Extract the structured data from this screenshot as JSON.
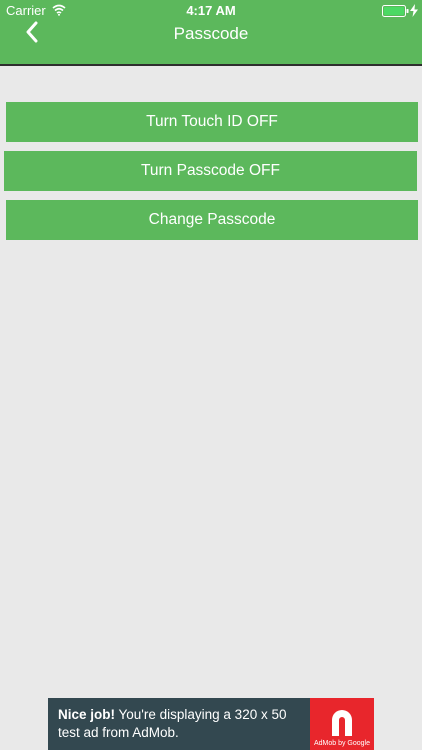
{
  "status_bar": {
    "carrier": "Carrier",
    "time": "4:17 AM"
  },
  "nav": {
    "title": "Passcode",
    "back_icon": "chevron-left-icon"
  },
  "buttons": {
    "touch_id": "Turn Touch ID OFF",
    "passcode": "Turn Passcode OFF",
    "change": "Change Passcode"
  },
  "ad": {
    "headline": "Nice job!",
    "body_line1": " You're displaying a 320 x 50",
    "body_line2": "test ad from AdMob.",
    "logo_label": "AdMob by Google"
  },
  "colors": {
    "accent": "#5cb85c",
    "background": "#e9e9e9",
    "ad_background": "#334850",
    "ad_logo": "#e8262c"
  }
}
